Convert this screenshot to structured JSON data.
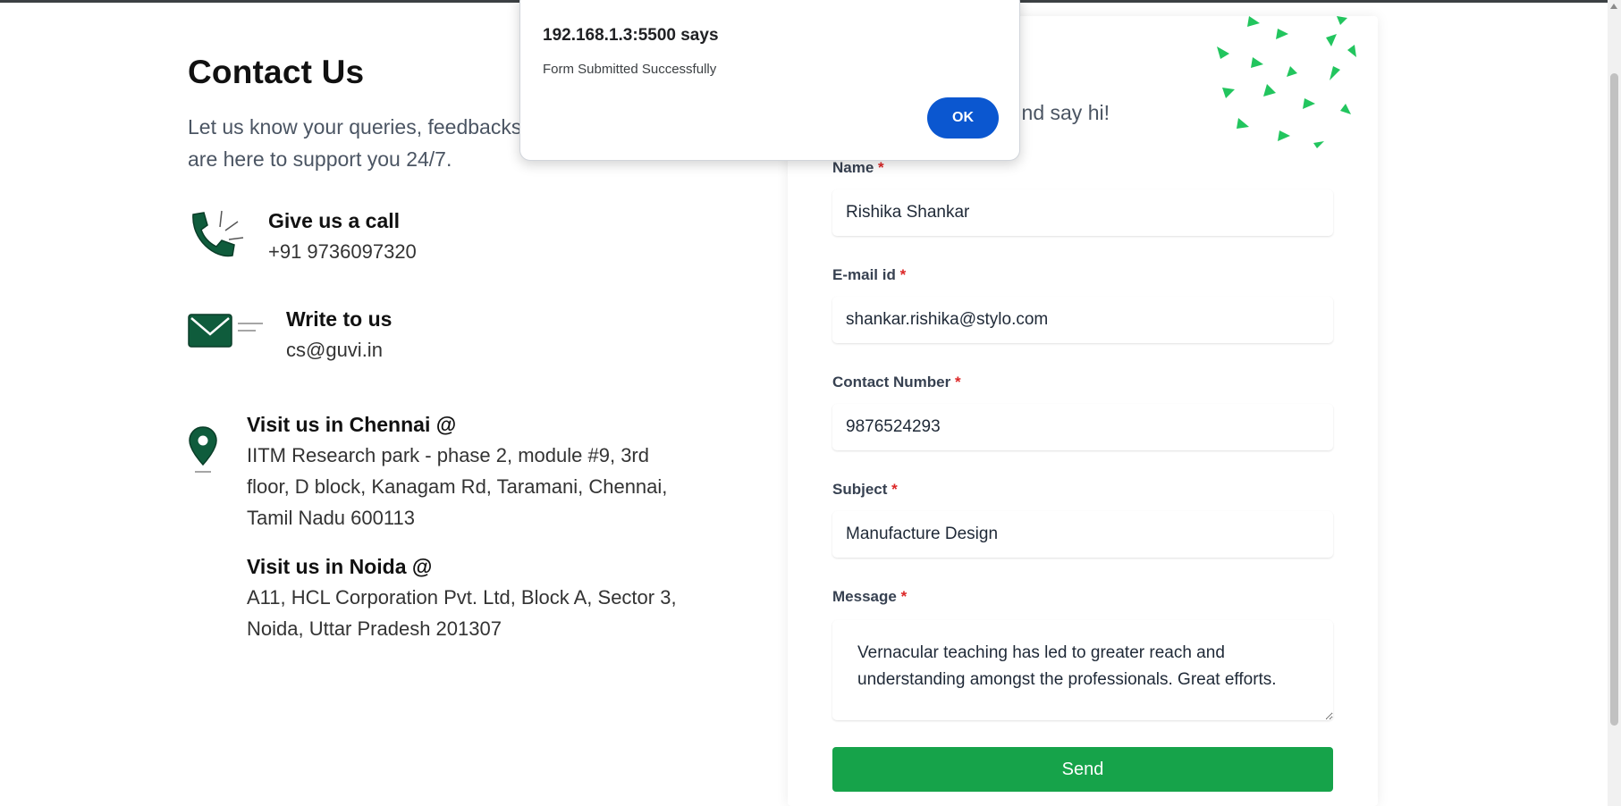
{
  "page": {
    "title": "Contact Us",
    "intro": "Let us know your queries, feedbacks, … we are here to support you 24/7.",
    "intro_line1": "Let us know your queries, feedbacks,",
    "intro_line2": "are here to support you 24/7."
  },
  "contact": {
    "call_title": "Give us a call",
    "call_value": "+91 9736097320",
    "mail_title": "Write to us",
    "mail_value": "cs@guvi.in",
    "chennai_title": "Visit us in Chennai @",
    "chennai_address": "IITM Research park - phase 2, module #9, 3rd floor, D block, Kanagam Rd, Taramani, Chennai, Tamil Nadu 600113",
    "noida_title": "Visit us in Noida @",
    "noida_address": "A11, HCL Corporation Pvt. Ltd, Block A, Sector 3, Noida, Uttar Pradesh 201307"
  },
  "form": {
    "subtitle": "nd say hi!",
    "required_marker": "*",
    "name_label": "Name",
    "name_value": "Rishika Shankar",
    "email_label": "E-mail id",
    "email_value": "shankar.rishika@stylo.com",
    "phone_label": "Contact Number",
    "phone_value": "9876524293",
    "subject_label": "Subject",
    "subject_value": "Manufacture Design",
    "message_label": "Message",
    "message_value": "Vernacular teaching has led to greater reach and understanding amongst the professionals. Great efforts.",
    "send_label": "Send"
  },
  "dialog": {
    "title": "192.168.1.3:5500 says",
    "message": "Form Submitted Successfully",
    "ok_label": "OK"
  },
  "colors": {
    "accent_green": "#16a34a",
    "icon_green": "#0f5c3c",
    "deco_green": "#22c55e",
    "dialog_button_blue": "#0b57d0",
    "required_red": "#dc2626"
  },
  "icons": [
    "phone-icon",
    "mail-icon",
    "location-pin-icon",
    "decorative-triangles"
  ]
}
